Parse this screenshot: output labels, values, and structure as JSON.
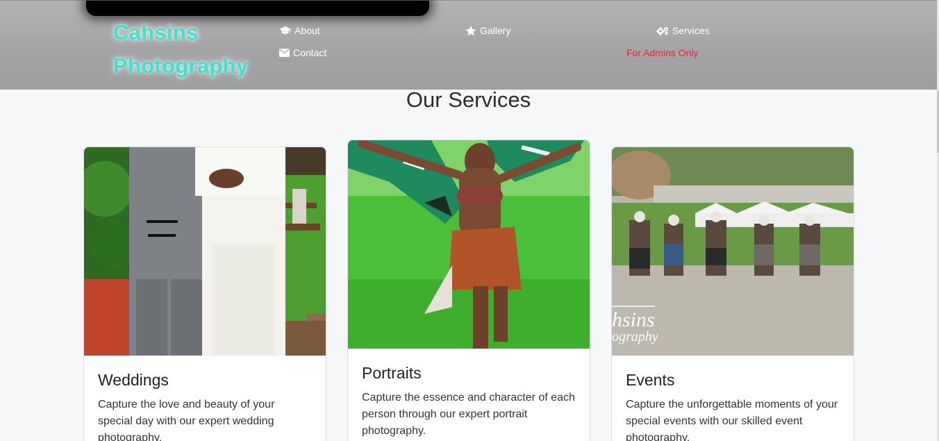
{
  "header": {
    "brand": "Cahsins Photography",
    "nav": {
      "about": "About",
      "contact": "Contact",
      "gallery": "Gallery",
      "services": "Services",
      "admins": "For Admins Only"
    },
    "colors": {
      "brand": "#3ee0cf",
      "admins": "#e8262b",
      "header_bg": "#a5a5a8"
    }
  },
  "services": {
    "title": "Our Services",
    "cards": [
      {
        "title": "Weddings",
        "text": "Capture the love and beauty of your special day with our expert wedding photography.",
        "image": "wedding-couple-photo"
      },
      {
        "title": "Portraits",
        "text": "Capture the essence and character of each person through our expert portrait photography.",
        "image": "portrait-dancer-photo"
      },
      {
        "title": "Events",
        "text": "Capture the unforgettable moments of your special events with our skilled event photography.",
        "image": "event-dancers-photo",
        "watermark": "hsins ography"
      }
    ]
  }
}
